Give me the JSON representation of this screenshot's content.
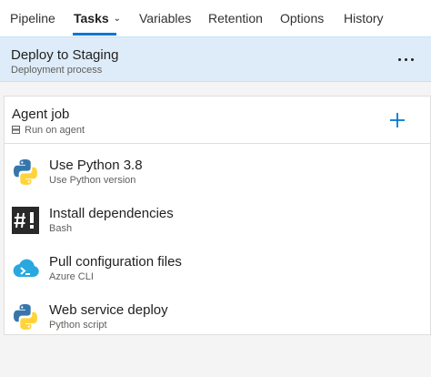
{
  "tabs": [
    {
      "label": "Pipeline"
    },
    {
      "label": "Tasks"
    },
    {
      "label": "Variables"
    },
    {
      "label": "Retention"
    },
    {
      "label": "Options"
    },
    {
      "label": "History"
    }
  ],
  "header": {
    "title": "Deploy to Staging",
    "subtitle": "Deployment process"
  },
  "agent_job": {
    "title": "Agent job",
    "subtitle": "Run on agent"
  },
  "tasks": [
    {
      "title": "Use Python 3.8",
      "subtitle": "Use Python version",
      "icon": "python-icon"
    },
    {
      "title": "Install dependencies",
      "subtitle": "Bash",
      "icon": "bash-icon"
    },
    {
      "title": "Pull configuration files",
      "subtitle": "Azure CLI",
      "icon": "azure-cli-icon"
    },
    {
      "title": "Web service deploy",
      "subtitle": "Python script",
      "icon": "python-icon"
    }
  ],
  "colors": {
    "accent": "#0078d4",
    "header_bg": "#deecf9",
    "python_blue": "#3776ab",
    "python_yellow": "#ffd43b"
  }
}
